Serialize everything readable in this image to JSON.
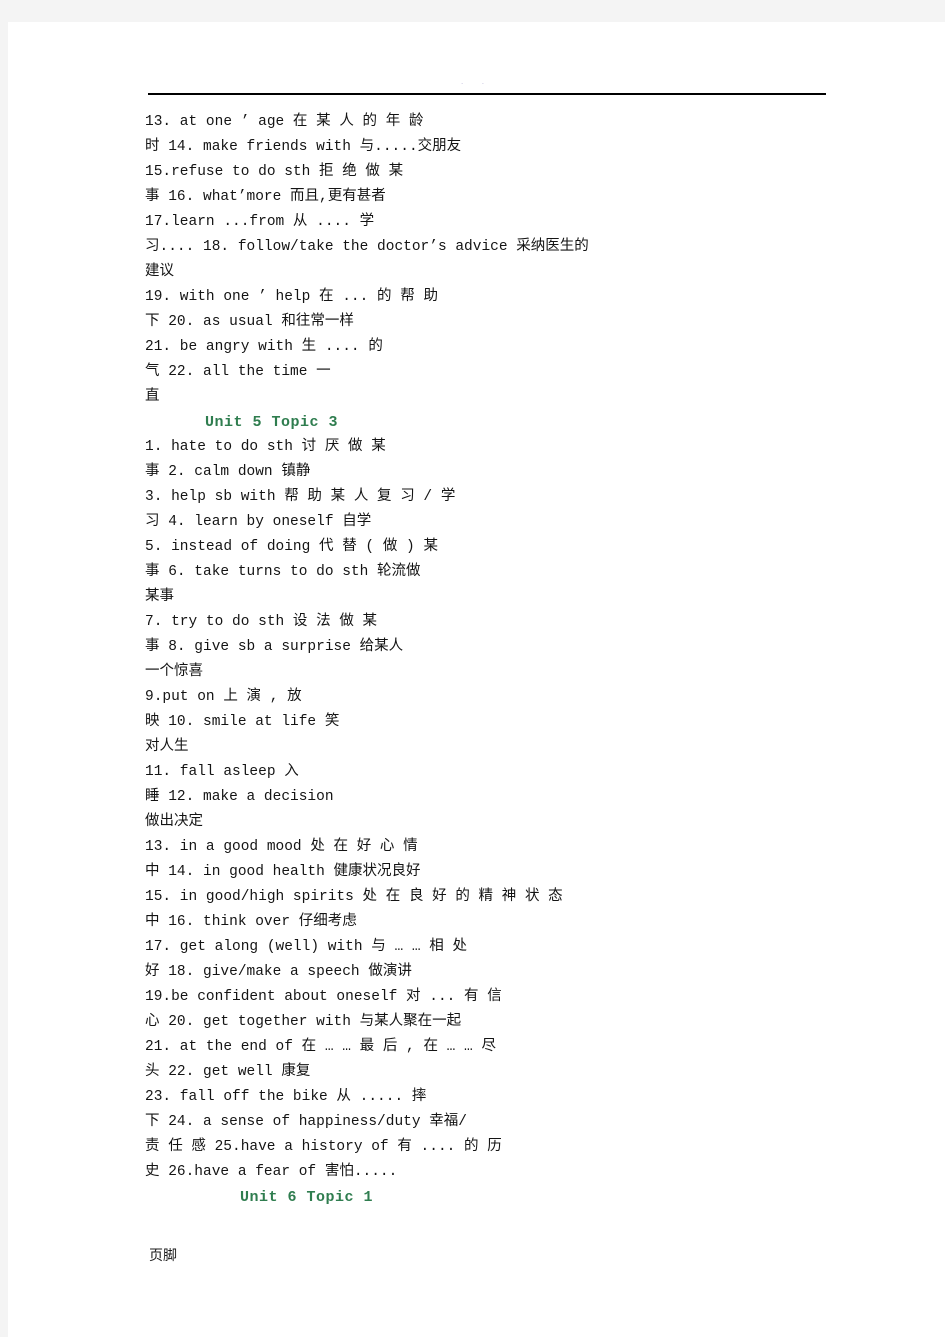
{
  "document": {
    "type": "vocabulary-phrase-list",
    "language_pair": "English-Chinese",
    "header_text": ". .",
    "footer_text": "页脚",
    "heading_color": "#2f7d4f",
    "body_color": "#141414"
  },
  "headings": {
    "unit5_topic3": "Unit  5    Topic  3",
    "unit6_topic1": "Unit  6  Topic  1"
  },
  "lines": [
    {
      "id": "l1",
      "text": "13.   at  one      ’      age         在     某     人     的     年     龄"
    },
    {
      "id": "l2",
      "text": "时                              14.   make  friends  with     与.....交朋友"
    },
    {
      "id": "l3",
      "text": "15.refuse  to  do  sth              拒        绝        做       某"
    },
    {
      "id": "l4",
      "text": "事                        16.   what’more    而且,更有甚者"
    },
    {
      "id": "l5",
      "text": "17.learn  ...from                  从             ....               学"
    },
    {
      "id": "l6",
      "text": "习....              18.  follow/take  the  doctor’s  advice    采纳医生的"
    },
    {
      "id": "l7",
      "text": "建议"
    },
    {
      "id": "l8",
      "text": "19.  with  one      ’      help          在     ...      的      帮     助"
    },
    {
      "id": "l9",
      "text": "下                      20.   as  usual    和往常一样"
    },
    {
      "id": "l10",
      "text": "21.  be  angry  with              生               ....                的"
    },
    {
      "id": "l11",
      "text": "气                              22.  all  the  time            一"
    },
    {
      "id": "l12",
      "text": "直"
    },
    {
      "id": "l13",
      "text": "1.  hate  to  do  sth             讨        厌        做       某"
    },
    {
      "id": "l14",
      "text": "事                           2.  calm  down   镇静"
    },
    {
      "id": "l15",
      "text": "3.  help  sb  with        帮     助     某     人     复     习     /     学"
    },
    {
      "id": "l16",
      "text": "习                  4.  learn  by  oneself    自学"
    },
    {
      "id": "l17",
      "text": "5.  instead  of  doing        代       替      (       做       )       某"
    },
    {
      "id": "l18",
      "text": "事                     6.   take   turns   to   do   sth   轮流做"
    },
    {
      "id": "l19",
      "text": "某事"
    },
    {
      "id": "l20",
      "text": "7.  try  to  do  sth            设        法        做       某"
    },
    {
      "id": "l21",
      "text": "事                       8.  give  sb   a  surprise   给某人"
    },
    {
      "id": "l22",
      "text": "一个惊喜"
    },
    {
      "id": "l23",
      "text": "9.put  on                上           演            ,             放"
    },
    {
      "id": "l24",
      "text": "映                                10.  smile  at  life    笑"
    },
    {
      "id": "l25",
      "text": "对人生"
    },
    {
      "id": "l26",
      "text": "11.  fall  asleep                                       入"
    },
    {
      "id": "l27",
      "text": "睡                                12.  make  a  decision"
    },
    {
      "id": "l28",
      "text": "    做出决定"
    },
    {
      "id": "l29",
      "text": "13.  in  a  good  mood          处      在      好      心      情"
    },
    {
      "id": "l30",
      "text": "中                   14.  in  good   health   健康状况良好"
    },
    {
      "id": "l31",
      "text": "15.  in  good/high  spirits      处   在   良   好   的   精   神   状   态"
    },
    {
      "id": "l32",
      "text": "中      16.    think  over   仔细考虑"
    },
    {
      "id": "l33",
      "text": "17.  get   along   (well)   with      与    …    …    相    处"
    },
    {
      "id": "l34",
      "text": "好            18.  give/make   a   speech  做演讲"
    },
    {
      "id": "l35",
      "text": "19.be  confident  about  oneself       对       ...       有       信"
    },
    {
      "id": "l36",
      "text": "心                  20.  get   together   with 与某人聚在一起"
    },
    {
      "id": "l37",
      "text": "21.  at   the   end   of     在 … …  最  后  ,   在  …  …  尽"
    },
    {
      "id": "l38",
      "text": "头       22.  get   well   康复"
    },
    {
      "id": "l39",
      "text": "23.  fall  off  the  bike           从            .....             摔"
    },
    {
      "id": "l40",
      "text": "下                   24.  a   sense   of   happiness/duty  幸福/"
    },
    {
      "id": "l41",
      "text": "责   任   感   25.have  a  history  of     有   ....   的   历"
    },
    {
      "id": "l42",
      "text": "史                26.have  a  fear  of   害怕....."
    }
  ]
}
